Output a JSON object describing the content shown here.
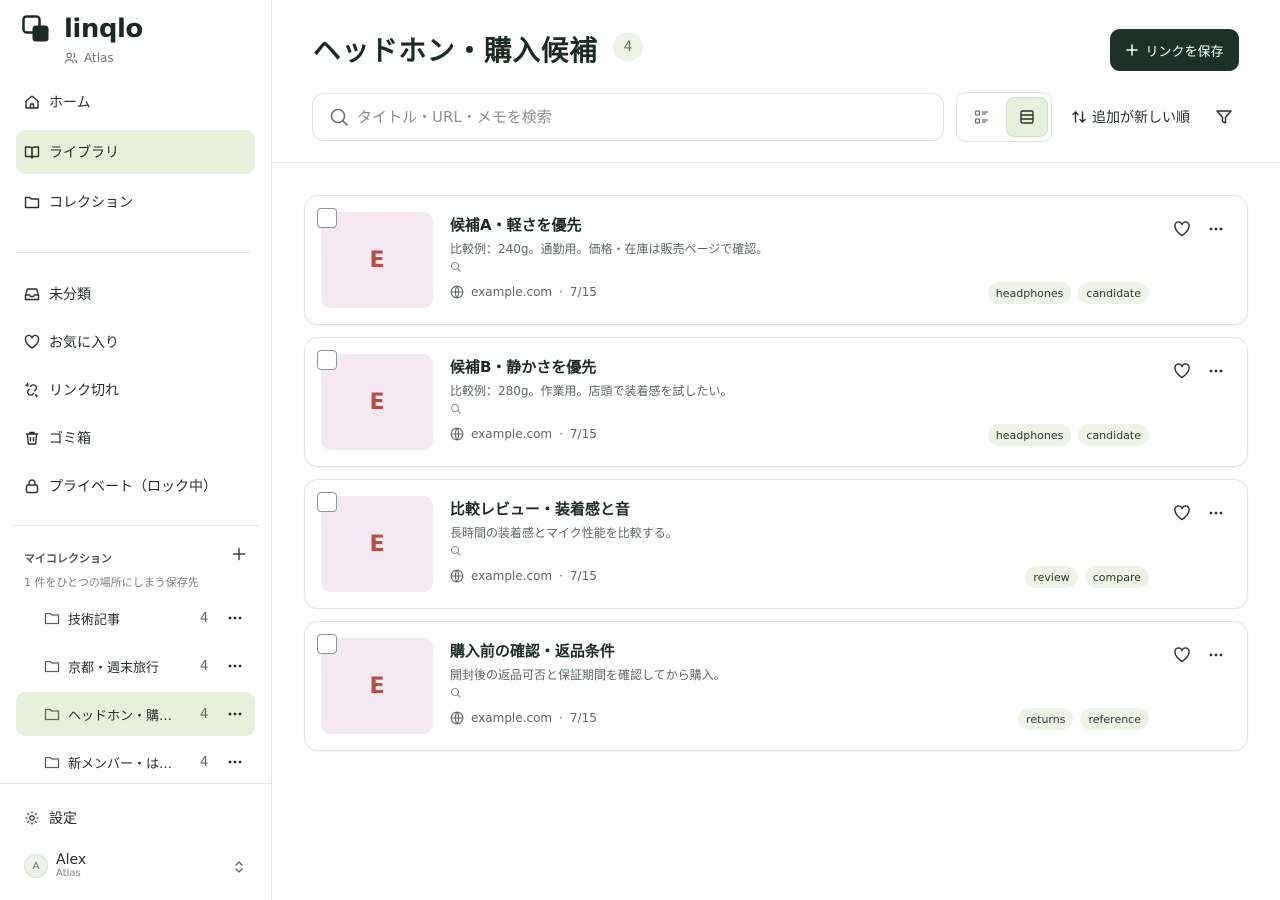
{
  "app": {
    "name": "linqlo",
    "workspace": "Atlas"
  },
  "nav": [
    {
      "label": "ホーム",
      "icon": "home-icon"
    },
    {
      "label": "ライブラリ",
      "icon": "book-icon",
      "active": true
    },
    {
      "label": "コレクション",
      "icon": "folder-icon"
    }
  ],
  "nav2": [
    {
      "label": "未分類",
      "icon": "inbox-icon"
    },
    {
      "label": "お気に入り",
      "icon": "heart-icon"
    },
    {
      "label": "リンク切れ",
      "icon": "broken-link-icon"
    },
    {
      "label": "ゴミ箱",
      "icon": "trash-icon"
    },
    {
      "label": "プライベート（ロック中）",
      "icon": "lock-icon"
    }
  ],
  "collections": {
    "title": "マイコレクション",
    "subtitle": "1 件をひとつの場所にしまう保存先",
    "items": [
      {
        "name": "技術記事",
        "count": "4"
      },
      {
        "name": "京都・週末旅行",
        "count": "4"
      },
      {
        "name": "ヘッドホン・購入候補",
        "count": "4",
        "active": true
      },
      {
        "name": "新メンバー・はじめに",
        "count": "4"
      }
    ]
  },
  "settings": {
    "label": "設定"
  },
  "user": {
    "initial": "A",
    "name": "Alex",
    "workspace": "Atlas"
  },
  "header": {
    "title": "ヘッドホン・購入候補",
    "count": "4",
    "save_label": "リンクを保存"
  },
  "search": {
    "placeholder": "タイトル・URL・メモを検索",
    "value": ""
  },
  "sort": {
    "label": "追加が新しい順"
  },
  "cards": [
    {
      "thumb": "E",
      "title": "候補A・軽さを優先",
      "desc": "比較例：240g。通勤用。価格・在庫は販売ページで確認。",
      "domain": "example.com",
      "date": "7/15",
      "tags": [
        "headphones",
        "candidate"
      ]
    },
    {
      "thumb": "E",
      "title": "候補B・静かさを優先",
      "desc": "比較例：280g。作業用。店頭で装着感を試したい。",
      "domain": "example.com",
      "date": "7/15",
      "tags": [
        "headphones",
        "candidate"
      ]
    },
    {
      "thumb": "E",
      "title": "比較レビュー・装着感と音",
      "desc": "長時間の装着感とマイク性能を比較する。",
      "domain": "example.com",
      "date": "7/15",
      "tags": [
        "review",
        "compare"
      ]
    },
    {
      "thumb": "E",
      "title": "購入前の確認・返品条件",
      "desc": "開封後の返品可否と保証期間を確認してから購入。",
      "domain": "example.com",
      "date": "7/15",
      "tags": [
        "returns",
        "reference"
      ]
    }
  ],
  "colors": {
    "accent": "#1c3128",
    "active_bg": "#e6f0da",
    "thumb_bg": "#f6e8f1",
    "thumb_text": "#b94f43",
    "tag_bg": "#eef3e6"
  }
}
